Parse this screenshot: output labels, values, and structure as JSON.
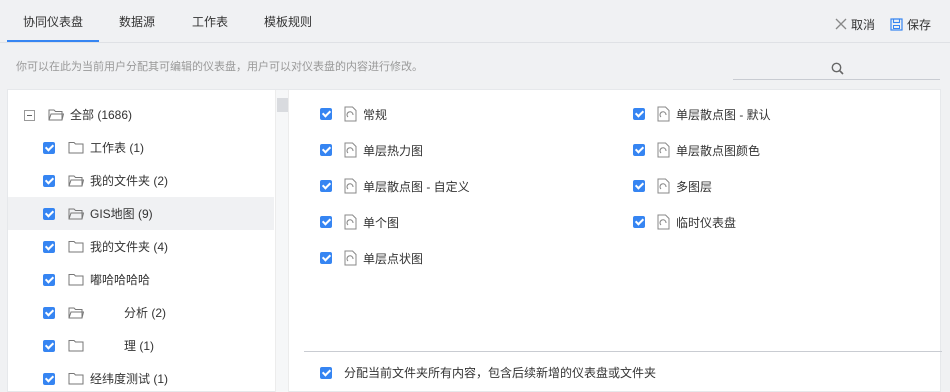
{
  "tabs": [
    {
      "label": "协同仪表盘",
      "active": true
    },
    {
      "label": "数据源",
      "active": false
    },
    {
      "label": "工作表",
      "active": false
    },
    {
      "label": "模板规则",
      "active": false
    }
  ],
  "actions": {
    "cancel_label": "取消",
    "save_label": "保存"
  },
  "description": "你可以在此为当前用户分配其可编辑的仪表盘，用户可以对仪表盘的内容进行修改。",
  "search": {
    "placeholder": "",
    "value": ""
  },
  "tree": {
    "root": {
      "label": "全部 (1686)"
    },
    "items": [
      {
        "label": "工作表 (1)",
        "checked": true,
        "open": false
      },
      {
        "label": "我的文件夹 (2)",
        "checked": true,
        "open": true
      },
      {
        "label": "GIS地图 (9)",
        "checked": true,
        "open": true,
        "selected": true
      },
      {
        "label": "我的文件夹 (4)",
        "checked": true,
        "open": false
      },
      {
        "label": "嘟哈哈哈哈",
        "checked": true,
        "open": false
      },
      {
        "label": "分析 (2)",
        "checked": true,
        "open": true
      },
      {
        "label": "理 (1)",
        "checked": true,
        "open": false
      },
      {
        "label": "经纬度测试 (1)",
        "checked": true,
        "open": false
      }
    ]
  },
  "reports": {
    "left": [
      "常规",
      "单层热力图",
      "单层散点图 - 自定义",
      "单个图",
      "单层点状图"
    ],
    "right": [
      "单层散点图 - 默认",
      "单层散点图颜色",
      "多图层",
      "临时仪表盘"
    ]
  },
  "footer": {
    "assign_all_label": "分配当前文件夹所有内容，包含后续新增的仪表盘或文件夹",
    "checked": true
  },
  "colors": {
    "accent": "#3685f2",
    "background": "#f0f1f3"
  }
}
